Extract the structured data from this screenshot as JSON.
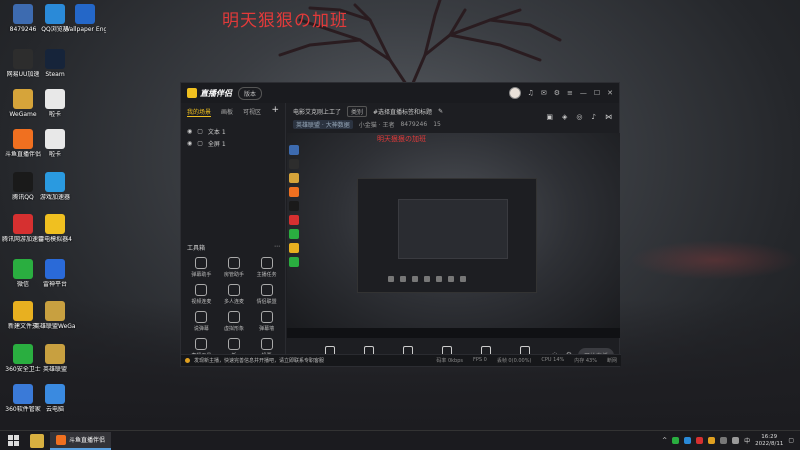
{
  "overlay": {
    "title": "明天狠狠の加班"
  },
  "desktop": {
    "icons": [
      {
        "label": "8479246",
        "icon": "user-icon",
        "color": "#3d6bb0"
      },
      {
        "label": "QQ浏览器",
        "icon": "browser-icon",
        "color": "#2a8ad8"
      },
      {
        "label": "Wallpaper Engine:...",
        "icon": "wallpaper-icon",
        "color": "#2467c8"
      },
      {
        "label": "网易UU加速",
        "icon": "uu-icon",
        "color": "#2d2d2d"
      },
      {
        "label": "Steam",
        "icon": "steam-icon",
        "color": "#16243a"
      },
      {
        "label": "WeGame",
        "icon": "wegame-icon",
        "color": "#d6a43a"
      },
      {
        "label": "啦卡",
        "icon": "file-icon",
        "color": "#e8e8e8"
      },
      {
        "label": "斗鱼直播伴侣",
        "icon": "douyu-icon",
        "color": "#f07020"
      },
      {
        "label": "啦卡",
        "icon": "file-icon",
        "color": "#e8e8e8"
      },
      {
        "label": "腾讯QQ",
        "icon": "qq-icon",
        "color": "#1a1a1a"
      },
      {
        "label": "游戏加速器",
        "icon": "game-icon",
        "color": "#2a9ae0"
      },
      {
        "label": "腾讯网游加速器",
        "icon": "tencent-icon",
        "color": "#d63030"
      },
      {
        "label": "雷电模拟器4",
        "icon": "emulator-icon",
        "color": "#f0c020"
      },
      {
        "label": "微信",
        "icon": "wechat-icon",
        "color": "#2aae40"
      },
      {
        "label": "雷神平台",
        "icon": "leishen-icon",
        "color": "#2a6ad8"
      },
      {
        "label": "新建文件夹",
        "icon": "folder-icon",
        "color": "#e8b020"
      },
      {
        "label": "英雄联盟WeGame版",
        "icon": "lol-icon",
        "color": "#c8a040"
      },
      {
        "label": "360安全卫士",
        "icon": "360-icon",
        "color": "#2aae40"
      },
      {
        "label": "英雄联盟",
        "icon": "lol-icon",
        "color": "#c8a040"
      },
      {
        "label": "360软件管家",
        "icon": "360soft-icon",
        "color": "#3a7ad8"
      },
      {
        "label": "云电脑",
        "icon": "cloud-icon",
        "color": "#3a8ae0"
      }
    ]
  },
  "app": {
    "name": "直播伴侣",
    "version_label": "版本",
    "tabs": [
      "我的场景",
      "画板",
      "可视区"
    ],
    "scenes": [
      "文本 1",
      "全屏 1"
    ],
    "tools_title": "工具箱",
    "tools": [
      "弹幕助手",
      "房管助手",
      "主播任务",
      "视频连麦",
      "多人连麦",
      "情侣联盟",
      "说弹幕",
      "虚拟形象",
      "弹幕墙",
      "直播工具",
      "新",
      "投票"
    ],
    "room": {
      "title": "电影艾克刚上工了",
      "category_btn": "类别",
      "subtitle": "#选择直播标签和标题",
      "tag": "英雄联盟 · 大神数据",
      "line2_a": "小金猫 · 王者",
      "room_id": "8479246",
      "count": "15"
    },
    "preview_title": "明天狠狠の加班",
    "controls": [
      {
        "label": "直播屏幕",
        "icon": "screen-icon"
      },
      {
        "label": "摄像头",
        "icon": "camera-icon"
      },
      {
        "label": "手机投屏",
        "icon": "phone-icon"
      },
      {
        "label": "多媒体",
        "icon": "media-icon"
      },
      {
        "label": "麦克风",
        "icon": "mic-icon"
      },
      {
        "label": "扬声器",
        "icon": "speaker-icon"
      }
    ],
    "start_label": "开始直播",
    "status": {
      "notice": "发现新主播，快速完善信息并开播吧，请立即联系专职客服",
      "stats": [
        "码率 0kbps",
        "FPS 0",
        "丢帧 0(0.00%)",
        "CPU 14%",
        "内存 43%",
        "断网"
      ]
    }
  },
  "taskbar": {
    "app_label": "斗鱼直播伴侣",
    "time": "16:29",
    "date": "2022/8/11"
  }
}
